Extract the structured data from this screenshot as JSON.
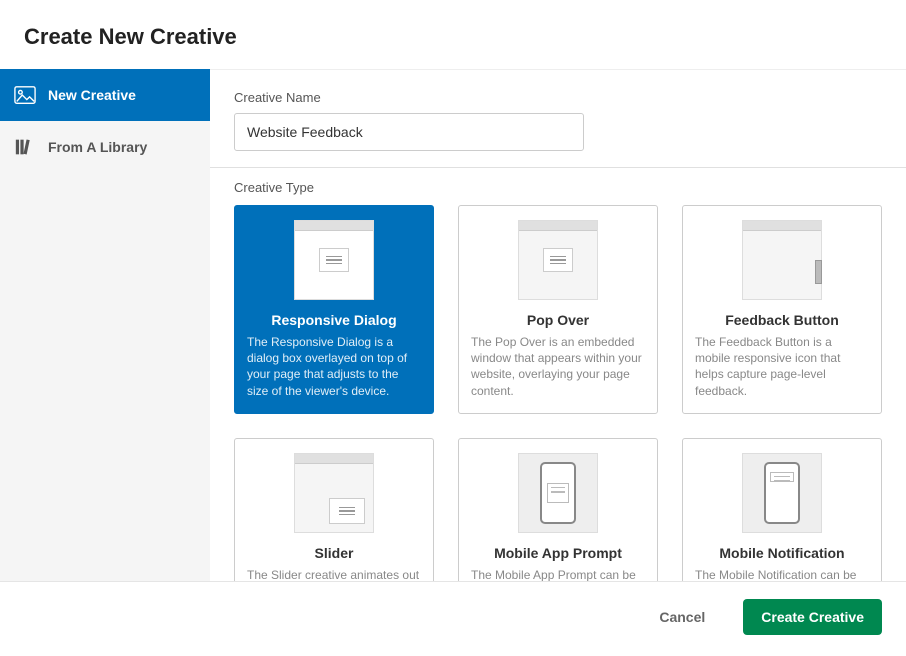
{
  "header": {
    "title": "Create New Creative"
  },
  "sidebar": {
    "items": [
      {
        "label": "New Creative",
        "active": true
      },
      {
        "label": "From A Library",
        "active": false
      }
    ]
  },
  "form": {
    "name_label": "Creative Name",
    "name_value": "Website Feedback",
    "type_label": "Creative Type"
  },
  "types": [
    {
      "title": "Responsive Dialog",
      "desc": "The Responsive Dialog is a dialog box overlayed on top of your page that adjusts to the size of the viewer's device.",
      "selected": true,
      "thumb": "dialog"
    },
    {
      "title": "Pop Over",
      "desc": "The Pop Over is an embedded window that appears within your website, overlaying your page content.",
      "selected": false,
      "thumb": "dialog"
    },
    {
      "title": "Feedback Button",
      "desc": "The Feedback Button is a mobile responsive icon that helps capture page-level feedback.",
      "selected": false,
      "thumb": "sidetab"
    },
    {
      "title": "Slider",
      "desc": "The Slider creative animates out",
      "selected": false,
      "thumb": "slider"
    },
    {
      "title": "Mobile App Prompt",
      "desc": "The Mobile App Prompt can be",
      "selected": false,
      "thumb": "phone-prompt"
    },
    {
      "title": "Mobile Notification",
      "desc": "The Mobile Notification can be",
      "selected": false,
      "thumb": "phone-notif"
    }
  ],
  "footer": {
    "cancel": "Cancel",
    "create": "Create Creative"
  }
}
